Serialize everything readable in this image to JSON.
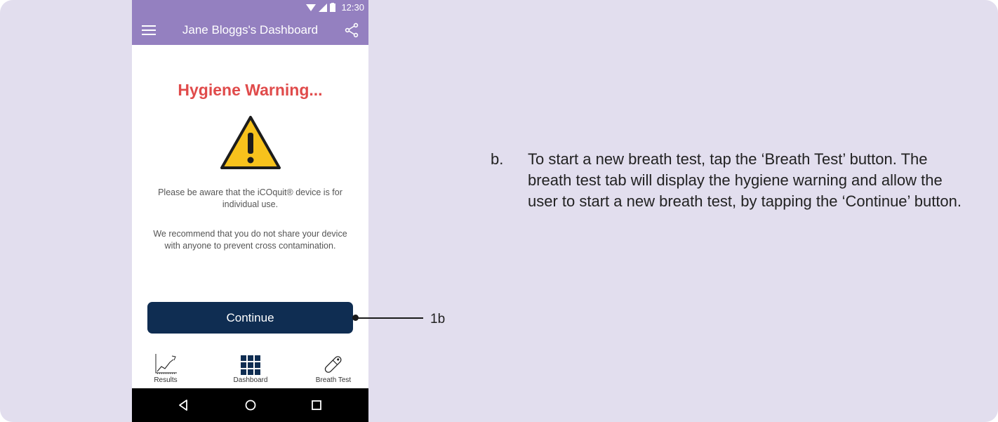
{
  "status_bar": {
    "time": "12:30"
  },
  "app_bar": {
    "title": "Jane Bloggs's Dashboard"
  },
  "warning": {
    "title": "Hygiene Warning...",
    "paragraph1": "Please be aware that the iCOquit® device is for individual use.",
    "paragraph2": "We recommend that you do not share your device with anyone to prevent cross contamination."
  },
  "continue_button": {
    "label": "Continue"
  },
  "bottom_nav": {
    "items": [
      {
        "label": "Results",
        "icon": "line-chart-icon"
      },
      {
        "label": "Dashboard",
        "icon": "grid-icon"
      },
      {
        "label": "Breath Test",
        "icon": "breath-device-icon"
      }
    ]
  },
  "callout": {
    "label": "1b"
  },
  "instruction": {
    "marker": "b.",
    "text": "To start a new breath test, tap the ‘Breath Test’ button. The breath test tab will display the hygiene warning and allow the user to start a new breath test, by tapping the ‘Continue’ button."
  },
  "colors": {
    "panel_bg": "#e2deee",
    "app_bar": "#9480c0",
    "warning_title": "#e04b4b",
    "button_bg": "#0f2d52",
    "warning_icon": "#f7c21c"
  }
}
